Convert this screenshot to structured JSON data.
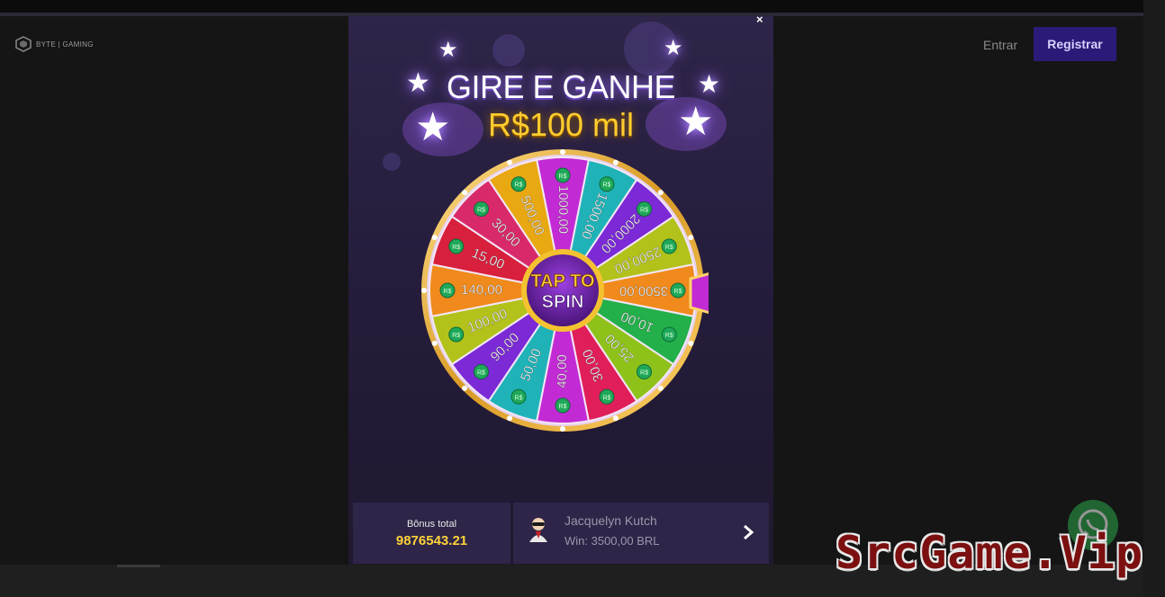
{
  "header": {
    "logo_text": "BYTE | GAMING",
    "login_label": "Entrar",
    "register_label": "Registrar"
  },
  "modal": {
    "close_label": "×",
    "title_line1": "GIRE E GANHE",
    "title_line2": "R$100 mil",
    "wheel": {
      "center_line1": "TAP TO",
      "center_line2": "SPIN",
      "coin_label": "R$",
      "segments": [
        {
          "value": "1000,00",
          "color": "#c22bd4"
        },
        {
          "value": "1500,00",
          "color": "#1fb3b8"
        },
        {
          "value": "2000,00",
          "color": "#7b2ad6"
        },
        {
          "value": "2500,00",
          "color": "#b3c21a"
        },
        {
          "value": "3500,00",
          "color": "#f08a1c"
        },
        {
          "value": "10,00",
          "color": "#23b04a"
        },
        {
          "value": "25,00",
          "color": "#8ec21a"
        },
        {
          "value": "30,00",
          "color": "#e01e5a"
        },
        {
          "value": "40,00",
          "color": "#c22bd4"
        },
        {
          "value": "50,00",
          "color": "#1fb3b8"
        },
        {
          "value": "90,00",
          "color": "#7b2ad6"
        },
        {
          "value": "100,00",
          "color": "#b3c21a"
        },
        {
          "value": "140,00",
          "color": "#f08a1c"
        },
        {
          "value": "15,00",
          "color": "#d81f3c"
        },
        {
          "value": "30,00",
          "color": "#d82a6a"
        },
        {
          "value": "500,00",
          "color": "#e8a812"
        }
      ]
    },
    "bonus": {
      "label": "Bônus total",
      "value": "9876543.21"
    },
    "winner": {
      "name": "Jacquelyn Kutch",
      "win": "Win: 3500,00 BRL"
    }
  },
  "watermark": "SrcGame.Vip",
  "icons": {
    "close": "close-icon",
    "chevron": "chevron-right-icon",
    "avatar": "avatar-icon",
    "whatsapp": "whatsapp-icon",
    "star": "star-icon"
  },
  "colors": {
    "modal_bg": "#2a2242",
    "title_gold": "#ffcc2e",
    "register_bg": "#2c1a78",
    "bonus_value": "#ffd23a"
  }
}
